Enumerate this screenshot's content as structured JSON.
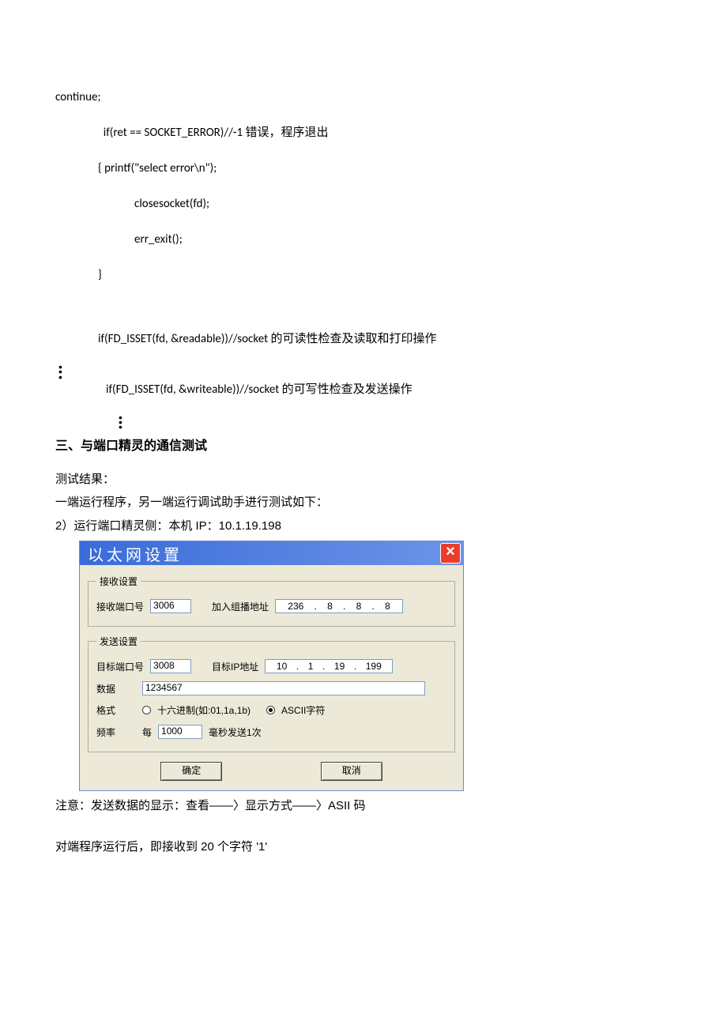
{
  "code": {
    "l1": "continue;",
    "l2": "  if(ret == SOCKET_ERROR)//-1 错误，程序退出",
    "l3": "{ printf(\"select error\\n\");",
    "l4": "closesocket(fd);",
    "l5": "err_exit();",
    "l6": "}",
    "l7": "if(FD_ISSET(fd, &readable))//socket 的可读性检查及读取和打印操作",
    "l8": "if(FD_ISSET(fd, &writeable))//socket 的可写性检查及发送操作"
  },
  "text": {
    "heading": "三、与端口精灵的通信测试",
    "result": "测试结果：",
    "desc": "一端运行程序，另一端运行调试助手进行测试如下：",
    "step2": "2）运行端口精灵侧：本机 IP：10.1.19.198",
    "note": "注意：发送数据的显示：查看——〉显示方式——〉ASII 码",
    "after": "对端程序运行后，即接收到 20 个字符 '1'"
  },
  "dialog": {
    "title": "以太网设置",
    "close": "×",
    "recv": {
      "legend": "接收设置",
      "portLabel": "接收端口号",
      "portValue": "3006",
      "multicastLabel": "加入组播地址",
      "ip": [
        "236",
        "8",
        "8",
        "8"
      ]
    },
    "send": {
      "legend": "发送设置",
      "portLabel": "目标端口号",
      "portValue": "3008",
      "ipLabel": "目标IP地址",
      "ip": [
        "10",
        "1",
        "19",
        "199"
      ],
      "dataLabel": "数据",
      "dataValue": "1234567",
      "formatLabel": "格式",
      "hexLabel": "十六进制(如:01,1a,1b)",
      "asciiLabel": "ASCII字符",
      "freqLabel": "频率",
      "everyLabel": "每",
      "msValue": "1000",
      "msSuffix": "毫秒发送1次"
    },
    "ok": "确定",
    "cancel": "取消"
  }
}
